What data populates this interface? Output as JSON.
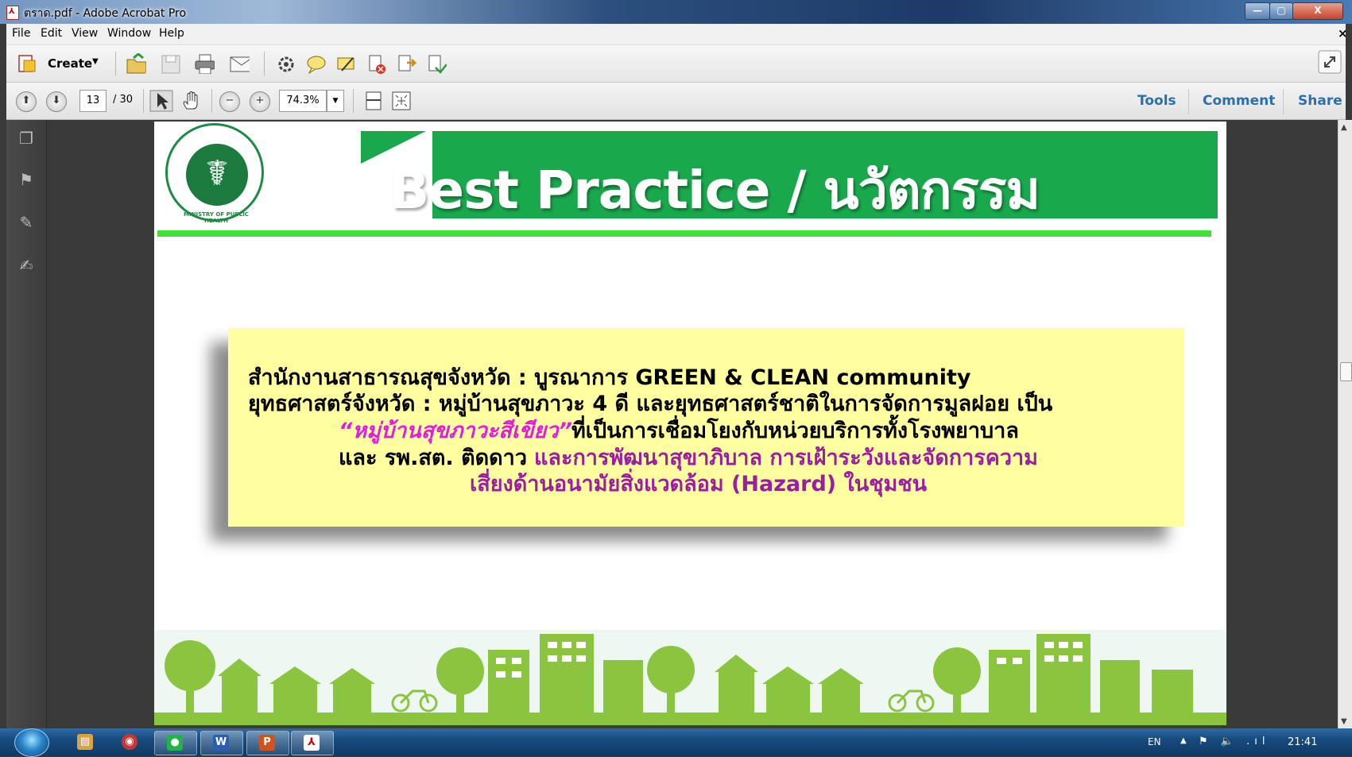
{
  "window": {
    "title": "ตราด.pdf - Adobe Acrobat Pro",
    "minimize": "—",
    "maximize": "▢",
    "close": "X"
  },
  "menu": {
    "items": [
      "File",
      "Edit",
      "View",
      "Window",
      "Help"
    ],
    "close_doc": "×"
  },
  "toolbar": {
    "create_label": "Create",
    "icons": [
      "open-folder-icon",
      "save-icon",
      "print-icon",
      "email-icon",
      "settings-icon",
      "comment-bubble-icon",
      "sign-icon",
      "delete-pdf-icon",
      "export-pdf-icon",
      "combine-icon",
      "fullscreen-icon"
    ]
  },
  "navigation": {
    "current_page": "13",
    "total_pages": "/ 30",
    "zoom": "74.3%"
  },
  "panes": {
    "tools": "Tools",
    "comment": "Comment",
    "share": "Share"
  },
  "slide": {
    "heading": "Best Practice / นวัตกรรม",
    "logo_text": "MINISTRY OF PUBLIC HEALTH",
    "line1": "สำนักงานสาธารณสุขจังหวัด : บูรณาการ GREEN & CLEAN community",
    "line2": "ยุทธศาสตร์จังหวัด  : หมู่บ้านสุขภาวะ 4 ดี และยุทธศาสตร์ชาติในการจัดการมูลฝอย เป็น",
    "line3_highlight": "“หมู่บ้านสุขภาวะสีเขียว”",
    "line3_rest": "ที่เป็นการเชื่อมโยงกับหน่วยบริการทั้งโรงพยาบาล",
    "line4_start": "และ รพ.สต. ติดดาว",
    "line4_purple": "และการพัฒนาสุขาภิบาล การเฝ้าระวังและจัดการความ",
    "line5": "เสี่ยงด้านอนามัยสิ่งแวดล้อม (Hazard) ในชุมชน"
  },
  "taskbar": {
    "language": "EN",
    "tray_arrow": "▲",
    "tray_icons": "⚑ 🔈 .ıl",
    "clock": "21:41",
    "apps": [
      {
        "name": "explorer",
        "glyph": "▤"
      },
      {
        "name": "chrome",
        "glyph": "◉"
      },
      {
        "name": "line",
        "glyph": "●"
      },
      {
        "name": "word",
        "glyph": "W"
      },
      {
        "name": "powerpoint",
        "glyph": "P"
      },
      {
        "name": "acrobat",
        "glyph": "⅄"
      }
    ]
  },
  "colors": {
    "banner_green": "#1aa84d",
    "stripe_green": "#41e03c",
    "note_yellow": "#ffff9f",
    "magenta": "#e01ddb",
    "purple": "#9b1ea0",
    "pane_link": "#2d6fa8"
  }
}
